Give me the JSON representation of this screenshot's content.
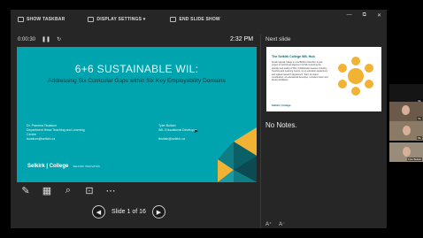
{
  "toolbar": {
    "show_taskbar": "SHOW TASKBAR",
    "display_settings": "DISPLAY SETTINGS ▾",
    "end_slide_show": "END SLIDE SHOW"
  },
  "window_controls": {
    "minimize": "—",
    "restore": "⧉",
    "close": "✕"
  },
  "timer": {
    "elapsed": "0:00:30",
    "pause_icon": "pause-icon",
    "reset_icon": "reset-icon"
  },
  "clock": "2:32 PM",
  "slide": {
    "title": "6+6 SUSTAINABLE WIL:",
    "subtitle": "Addressing Six Curricular Gaps within Six Key Employability Domains",
    "presenter1": {
      "name": "Dr. Pravena Tsuakum",
      "role1": "Department Head Teaching and Learning",
      "role2": "Centre",
      "email": "tsuakum@selkirk.ca"
    },
    "presenter2": {
      "name": "Tyler Bullain",
      "role": "WIL Educational Developer",
      "email": "tbullain@selkirk.ca"
    },
    "logo": "Selkirk | College",
    "logo_tag": "SELKIRK INNOVATES",
    "accent": "#00a4ae"
  },
  "tools": [
    "pen-icon",
    "slides-grid-icon",
    "zoom-icon",
    "camera-off-icon",
    "more-icon"
  ],
  "nav": {
    "label": "Slide 1 of 16",
    "prev": "◀",
    "next": "▶"
  },
  "next_slide": {
    "label": "Next slide",
    "title": "The Selkirk College WIL Hub",
    "body": "Small regional college in rural British Columbia. 6-year project to build broad alignment of WIL improving the quantity and quality of WIL. Collaboration between industry, Teaching and Learning Centre, co-op education department and applied research department. Team of project coordinators, an educational developer, a student intern and faculty facilitators.",
    "logo": "Selkirk | College"
  },
  "notes": "No Notes.",
  "font_controls": {
    "increase": "A⁺",
    "decrease": "A⁻"
  },
  "participants": [
    {
      "label": "ML"
    },
    {
      "label": "ML"
    },
    {
      "label": "ML"
    },
    {
      "label": "Tyler Bullain"
    }
  ]
}
